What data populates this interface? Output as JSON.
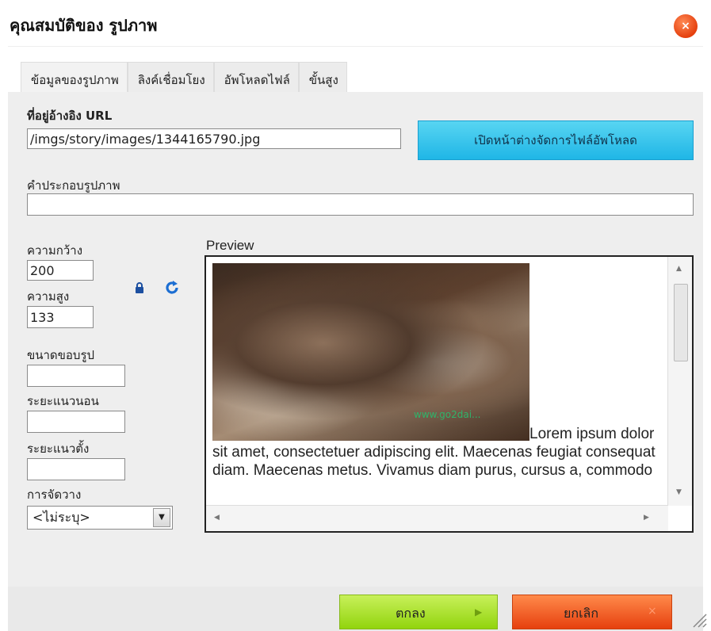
{
  "dialog": {
    "title": "คุณสมบัติของ รูปภาพ",
    "close_symbol": "×"
  },
  "tabs": [
    {
      "label": "ข้อมูลของรูปภาพ",
      "active": true
    },
    {
      "label": "ลิงค์เชื่อมโยง",
      "active": false
    },
    {
      "label": "อัพโหลดไฟล์",
      "active": false
    },
    {
      "label": "ขั้นสูง",
      "active": false
    }
  ],
  "image_info": {
    "url_label_bold": "ที่อยู่อ้างอิง",
    "url_label_suffix": " URL",
    "url_value": "/imgs/story/images/1344165790.jpg",
    "browse_button": "เปิดหน้าต่างจัดการไฟล์อัพโหลด",
    "caption_label": "คำประกอบรูปภาพ",
    "caption_value": "",
    "width_label": "ความกว้าง",
    "width_value": "200",
    "height_label": "ความสูง",
    "height_value": "133",
    "border_label": "ขนาดขอบรูป",
    "border_value": "",
    "hspace_label": "ระยะแนวนอน",
    "hspace_value": "",
    "vspace_label": "ระยะแนวตั้ง",
    "vspace_value": "",
    "align_label": "การจัดวาง",
    "align_value": "<ไม่ระบุ>",
    "preview_label": "Preview",
    "preview_watermark": "www.go2dai...",
    "preview_text": "Lorem ipsum dolor sit amet, consectetuer adipiscing elit. Maecenas feugiat consequat diam. Maecenas metus. Vivamus diam purus, cursus a, commodo"
  },
  "footer": {
    "ok_label": "ตกลง",
    "cancel_label": "ยกเลิก"
  },
  "colors": {
    "browse_button": "#1fb6e6",
    "ok_button": "#92d40e",
    "cancel_button": "#e6400f",
    "close_button": "#e5400e"
  }
}
